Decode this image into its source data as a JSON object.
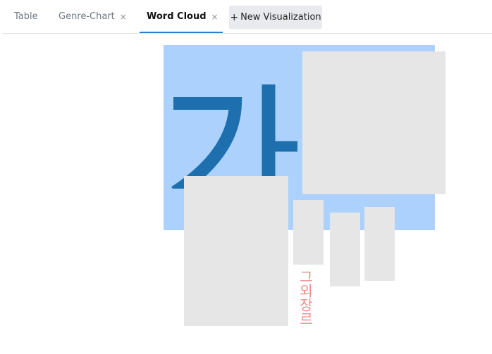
{
  "tabs": [
    {
      "label": "Table",
      "closable": false,
      "active": false
    },
    {
      "label": "Genre-Chart",
      "closable": true,
      "close_glyph": "×",
      "active": false
    },
    {
      "label": "Word Cloud",
      "closable": true,
      "close_glyph": "×",
      "active": true
    }
  ],
  "new_visualization": {
    "plus": "+",
    "label": "New Visualization"
  },
  "word_cloud": {
    "words": [
      {
        "text": "가",
        "color": "#1d6fad",
        "highlight_color": "#abd1fc",
        "orientation": "horizontal"
      },
      {
        "text": "그외장르",
        "color": "#ee8c8c",
        "orientation": "vertical"
      }
    ],
    "placeholder_color": "#e6e6e6"
  },
  "colors": {
    "accent": "#2b7fd2",
    "tab_active": "#111111",
    "tab_inactive": "#6f7780",
    "button_bg": "#e8eaed"
  }
}
